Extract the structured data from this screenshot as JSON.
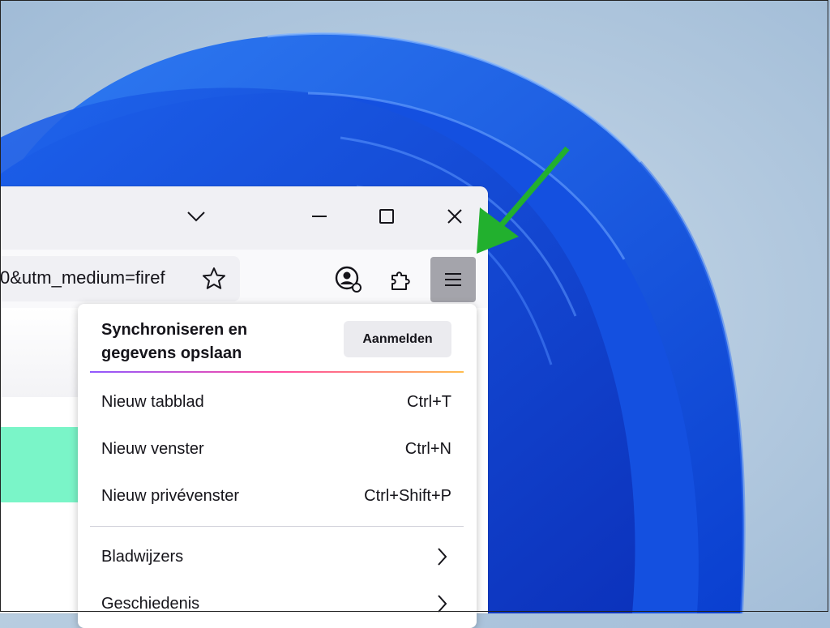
{
  "browser": {
    "url_fragment": "0&utm_medium=firef",
    "titlebar": {
      "tab_list_icon": "chevron-down-icon",
      "minimize_icon": "minimize-icon",
      "maximize_icon": "maximize-icon",
      "close_icon": "close-icon"
    },
    "toolbar": {
      "bookmark_icon": "star-icon",
      "account_icon": "account-icon",
      "extensions_icon": "puzzle-icon",
      "menu_icon": "hamburger-icon"
    }
  },
  "app_menu": {
    "sync_title": "Synchroniseren en gegevens opslaan",
    "sign_in_label": "Aanmelden",
    "items": [
      {
        "label": "Nieuw tabblad",
        "shortcut": "Ctrl+T"
      },
      {
        "label": "Nieuw venster",
        "shortcut": "Ctrl+N"
      },
      {
        "label": "Nieuw privévenster",
        "shortcut": "Ctrl+Shift+P"
      },
      {
        "label": "Bladwijzers",
        "shortcut": ""
      },
      {
        "label": "Geschiedenis",
        "shortcut": ""
      }
    ]
  },
  "annotation": {
    "arrow_color": "#22b02e"
  }
}
